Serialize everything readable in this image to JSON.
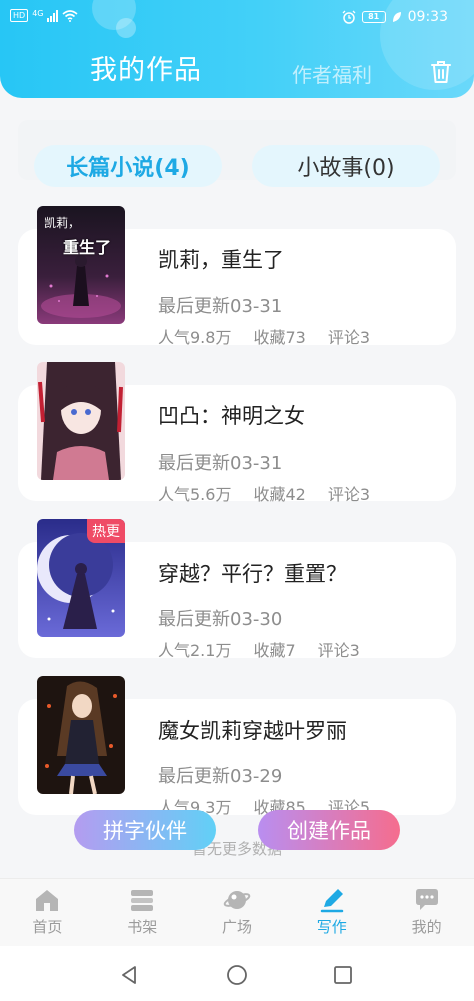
{
  "status_bar": {
    "hd": "HD",
    "network": "4G",
    "battery": "81",
    "time": "09:33"
  },
  "header": {
    "title": "我的作品",
    "welfare": "作者福利"
  },
  "tabs": [
    {
      "label": "长篇小说(4)",
      "active": true
    },
    {
      "label": "小故事(0)",
      "active": false
    }
  ],
  "works": [
    {
      "title": "凯莉，重生了",
      "updated": "最后更新03-31",
      "popularity": "人气9.8万",
      "favorites": "收藏73",
      "comments": "评论3",
      "cover_text_line1": "凯莉，",
      "cover_text_line2": "重生了"
    },
    {
      "title": "凹凸：神明之女",
      "updated": "最后更新03-31",
      "popularity": "人气5.6万",
      "favorites": "收藏42",
      "comments": "评论3"
    },
    {
      "title": "穿越？平行？重置？",
      "updated": "最后更新03-30",
      "popularity": "人气2.1万",
      "favorites": "收藏7",
      "comments": "评论3",
      "badge": "热更"
    },
    {
      "title": "魔女凯莉穿越叶罗丽",
      "updated": "最后更新03-29",
      "popularity": "人气9.3万",
      "favorites": "收藏85",
      "comments": "评论5"
    }
  ],
  "list_footer": "暂无更多数据",
  "floating_buttons": {
    "partner": "拼字伙伴",
    "create": "创建作品"
  },
  "bottom_nav": [
    {
      "label": "首页",
      "icon": "home-icon"
    },
    {
      "label": "书架",
      "icon": "bookshelf-icon"
    },
    {
      "label": "广场",
      "icon": "planet-icon"
    },
    {
      "label": "写作",
      "icon": "pen-icon",
      "active": true
    },
    {
      "label": "我的",
      "icon": "message-icon"
    }
  ],
  "colors": {
    "accent": "#1ea9e4",
    "header_start": "#27c6f5",
    "header_end": "#6ad8fa",
    "badge": "#ef4b66"
  }
}
